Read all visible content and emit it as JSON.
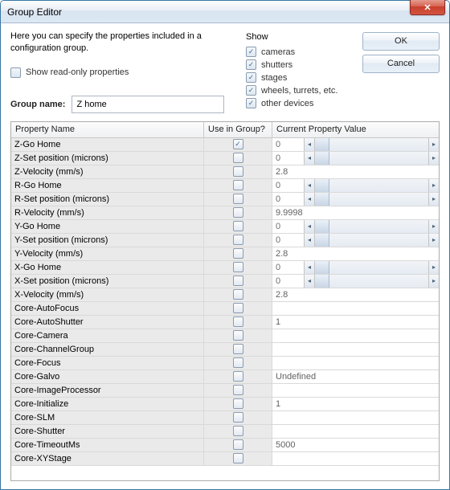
{
  "window": {
    "title": "Group Editor"
  },
  "intro": "Here you can specify the properties included in a configuration group.",
  "readonly": {
    "label": "Show read-only properties",
    "checked": false
  },
  "groupname": {
    "label": "Group name:",
    "value": "Z home"
  },
  "show": {
    "header": "Show",
    "items": [
      {
        "label": "cameras",
        "checked": true
      },
      {
        "label": "shutters",
        "checked": true
      },
      {
        "label": "stages",
        "checked": true
      },
      {
        "label": "wheels, turrets, etc.",
        "checked": true
      },
      {
        "label": "other devices",
        "checked": true
      }
    ]
  },
  "buttons": {
    "ok": "OK",
    "cancel": "Cancel"
  },
  "table": {
    "headers": {
      "c1": "Property Name",
      "c2": "Use in Group?",
      "c3": "Current Property Value"
    },
    "rows": [
      {
        "name": "Z-Go Home",
        "use": true,
        "kind": "slider",
        "value": "0"
      },
      {
        "name": "Z-Set position (microns)",
        "use": false,
        "kind": "slider",
        "value": "0"
      },
      {
        "name": "Z-Velocity (mm/s)",
        "use": false,
        "kind": "text",
        "value": "2.8"
      },
      {
        "name": "R-Go Home",
        "use": false,
        "kind": "slider",
        "value": "0"
      },
      {
        "name": "R-Set position (microns)",
        "use": false,
        "kind": "slider",
        "value": "0"
      },
      {
        "name": "R-Velocity (mm/s)",
        "use": false,
        "kind": "text",
        "value": "9.9998"
      },
      {
        "name": "Y-Go Home",
        "use": false,
        "kind": "slider",
        "value": "0"
      },
      {
        "name": "Y-Set position (microns)",
        "use": false,
        "kind": "slider",
        "value": "0"
      },
      {
        "name": "Y-Velocity (mm/s)",
        "use": false,
        "kind": "text",
        "value": "2.8"
      },
      {
        "name": "X-Go Home",
        "use": false,
        "kind": "slider",
        "value": "0"
      },
      {
        "name": "X-Set position (microns)",
        "use": false,
        "kind": "slider",
        "value": "0"
      },
      {
        "name": "X-Velocity (mm/s)",
        "use": false,
        "kind": "text",
        "value": "2.8"
      },
      {
        "name": "Core-AutoFocus",
        "use": false,
        "kind": "text",
        "value": ""
      },
      {
        "name": "Core-AutoShutter",
        "use": false,
        "kind": "text",
        "value": "1"
      },
      {
        "name": "Core-Camera",
        "use": false,
        "kind": "text",
        "value": ""
      },
      {
        "name": "Core-ChannelGroup",
        "use": false,
        "kind": "text",
        "value": ""
      },
      {
        "name": "Core-Focus",
        "use": false,
        "kind": "text",
        "value": ""
      },
      {
        "name": "Core-Galvo",
        "use": false,
        "kind": "text",
        "value": "Undefined"
      },
      {
        "name": "Core-ImageProcessor",
        "use": false,
        "kind": "text",
        "value": ""
      },
      {
        "name": "Core-Initialize",
        "use": false,
        "kind": "text",
        "value": "1"
      },
      {
        "name": "Core-SLM",
        "use": false,
        "kind": "text",
        "value": ""
      },
      {
        "name": "Core-Shutter",
        "use": false,
        "kind": "text",
        "value": ""
      },
      {
        "name": "Core-TimeoutMs",
        "use": false,
        "kind": "text",
        "value": "5000"
      },
      {
        "name": "Core-XYStage",
        "use": false,
        "kind": "text",
        "value": ""
      }
    ]
  }
}
